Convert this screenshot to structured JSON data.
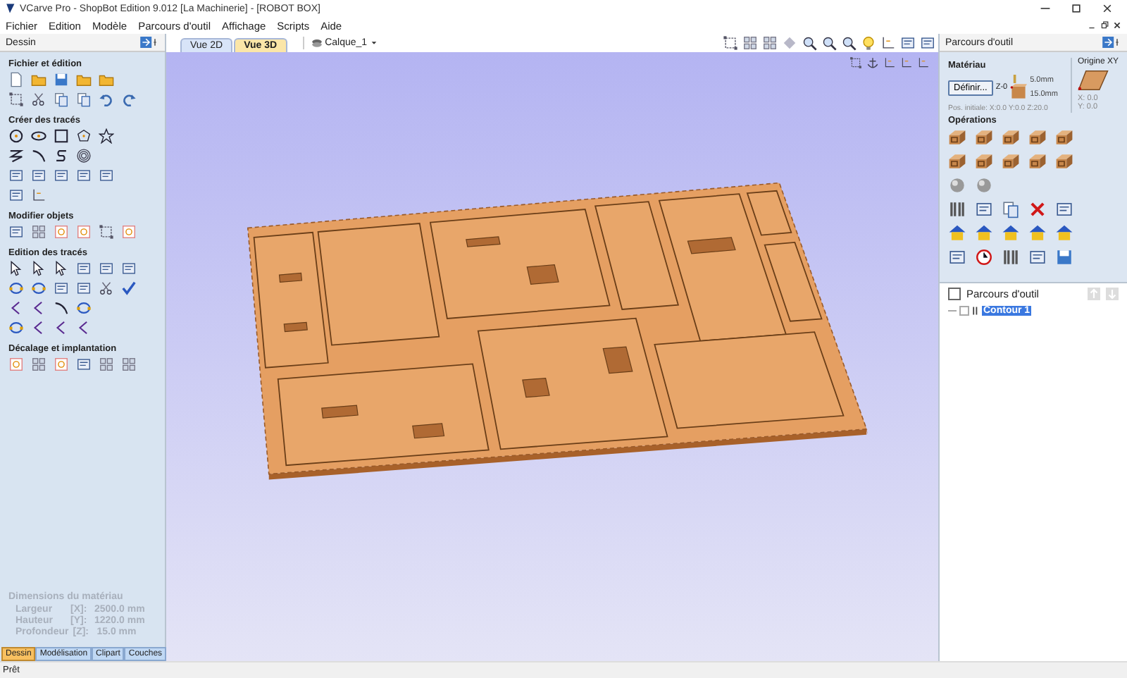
{
  "window": {
    "title": "VCarve Pro - ShopBot Edition 9.012 [La Machinerie] - [ROBOT BOX]"
  },
  "menu": [
    "Fichier",
    "Edition",
    "Modèle",
    "Parcours d'outil",
    "Affichage",
    "Scripts",
    "Aide"
  ],
  "left_panel": {
    "title": "Dessin",
    "sections": [
      {
        "title": "Fichier et édition"
      },
      {
        "title": "Créer des tracés"
      },
      {
        "title": "Modifier objets"
      },
      {
        "title": "Edition des tracés"
      },
      {
        "title": "Décalage et implantation"
      }
    ],
    "material": {
      "title": "Dimensions du matériau",
      "rows": [
        {
          "label": "Largeur",
          "axis": "[X]:",
          "value": "2500.0 mm"
        },
        {
          "label": "Hauteur",
          "axis": "[Y]:",
          "value": "1220.0 mm"
        },
        {
          "label": "Profondeur",
          "axis": "[Z]:",
          "value": "15.0 mm"
        }
      ]
    },
    "tabs": [
      {
        "label": "Dessin",
        "selected": true
      },
      {
        "label": "Modélisation",
        "selected": false
      },
      {
        "label": "Clipart",
        "selected": false
      },
      {
        "label": "Couches",
        "selected": false
      }
    ]
  },
  "view_tabs": [
    {
      "label": "Vue 2D",
      "selected": false
    },
    {
      "label": "Vue 3D",
      "selected": true
    }
  ],
  "layer": {
    "label": "Calque_1"
  },
  "right_panel": {
    "title": "Parcours d'outil",
    "material": {
      "title": "Matériau",
      "button": "Définir...",
      "z_label": "Z-0",
      "top_gap": "5.0mm",
      "thickness": "15.0mm",
      "home": "Pos. initiale: X:0.0 Y:0.0 Z:20.0"
    },
    "origin": {
      "title": "Origine XY",
      "x": "X: 0.0",
      "y": "Y: 0.0"
    },
    "operations_title": "Opérations",
    "toolpaths": {
      "label": "Parcours d'outil",
      "checked": false,
      "items": [
        {
          "label": "Contour 1",
          "checked": false,
          "selected": true
        }
      ]
    }
  },
  "status_bar": "Prêt"
}
